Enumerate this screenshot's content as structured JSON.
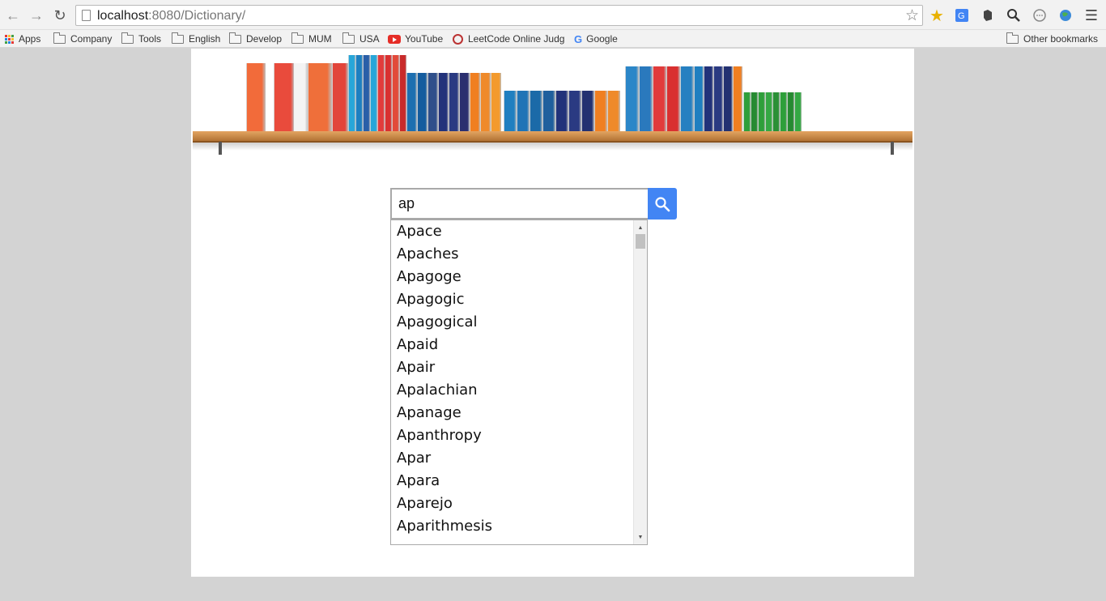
{
  "browser": {
    "url_host": "localhost",
    "url_rest": ":8080/Dictionary/"
  },
  "bookmarks": {
    "items": [
      "Apps",
      "Company",
      "Tools",
      "English",
      "Develop",
      "MUM",
      "USA",
      "YouTube",
      "LeetCode Online Judg",
      "Google"
    ],
    "other": "Other bookmarks"
  },
  "search": {
    "value": "ap",
    "icon": "search-icon",
    "button_color": "#4285f4"
  },
  "suggestions": [
    "Apace",
    "Apaches",
    "Apagoge",
    "Apagogic",
    "Apagogical",
    "Apaid",
    "Apair",
    "Apalachian",
    "Apanage",
    "Apanthropy",
    "Apar",
    "Apara",
    "Aparejo",
    "Aparithmesis"
  ]
}
